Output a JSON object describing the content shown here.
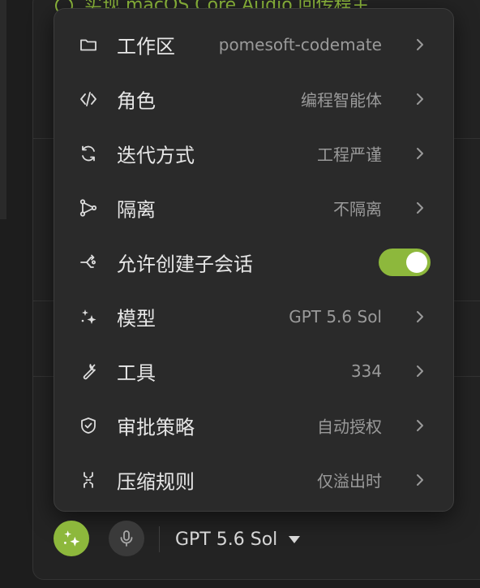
{
  "background": {
    "title": "实现 macOS Core Audio 回传程主"
  },
  "menu": {
    "items": [
      {
        "icon": "folder-icon",
        "label": "工作区",
        "value": "pomesoft-codemate",
        "control": "chevron"
      },
      {
        "icon": "code-icon",
        "label": "角色",
        "value": "编程智能体",
        "control": "chevron"
      },
      {
        "icon": "refresh-icon",
        "label": "迭代方式",
        "value": "工程严谨",
        "control": "chevron"
      },
      {
        "icon": "branch-icon",
        "label": "隔离",
        "value": "不隔离",
        "control": "chevron"
      },
      {
        "icon": "fork-icon",
        "label": "允许创建子会话",
        "value": "",
        "control": "toggle",
        "toggle_on": true
      },
      {
        "icon": "sparkles-icon",
        "label": "模型",
        "value": "GPT 5.6 Sol",
        "control": "chevron"
      },
      {
        "icon": "wrench-icon",
        "label": "工具",
        "value": "334",
        "control": "chevron"
      },
      {
        "icon": "shield-check-icon",
        "label": "审批策略",
        "value": "自动授权",
        "control": "chevron"
      },
      {
        "icon": "compress-icon",
        "label": "压缩规则",
        "value": "仅溢出时",
        "control": "chevron"
      }
    ]
  },
  "toolbar": {
    "model_label": "GPT 5.6 Sol",
    "spark_icon": "sparkles-icon",
    "mic_icon": "microphone-icon"
  },
  "colors": {
    "accent": "#8db83c",
    "menu_bg": "#2a2a2a",
    "label": "#e6e6e6",
    "value": "#9a9a9a"
  }
}
